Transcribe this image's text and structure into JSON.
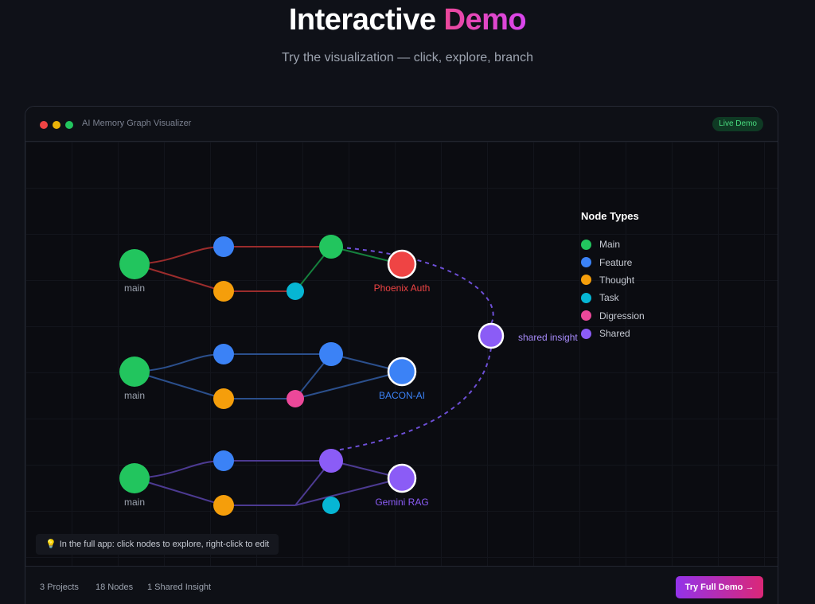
{
  "hero": {
    "title_main": "Interactive",
    "title_accent": "Demo",
    "subtitle": "Try the visualization — click, explore, branch"
  },
  "window": {
    "title": "AI Memory Graph Visualizer",
    "badge": "Live Demo"
  },
  "colors": {
    "main": "#22c55e",
    "feature": "#3b82f6",
    "thought": "#f59e0b",
    "task": "#06b6d4",
    "digression": "#ec4899",
    "shared": "#8b5cf6",
    "phoenix": "#ef4444"
  },
  "legend": {
    "title": "Node Types",
    "items": [
      {
        "label": "Main",
        "color": "#22c55e"
      },
      {
        "label": "Feature",
        "color": "#3b82f6"
      },
      {
        "label": "Thought",
        "color": "#f59e0b"
      },
      {
        "label": "Task",
        "color": "#06b6d4"
      },
      {
        "label": "Digression",
        "color": "#ec4899"
      },
      {
        "label": "Shared",
        "color": "#8b5cf6"
      }
    ]
  },
  "graph": {
    "projects": [
      {
        "name": "Phoenix Auth",
        "name_color": "#ef4444",
        "main_label": "main",
        "edge_color": "#9b2c2c",
        "branch_edge_color": "#15803d",
        "nodes": {
          "main": "main",
          "top1": "feature",
          "bottom1": "thought",
          "bottom2": "task",
          "top2": "main",
          "end": "phoenix"
        }
      },
      {
        "name": "BACON-AI",
        "name_color": "#3b82f6",
        "main_label": "main",
        "edge_color": "#2b4f8c",
        "nodes": {
          "main": "main",
          "top1": "feature",
          "bottom1": "thought",
          "bottom2": "digression",
          "top2": "feature",
          "end": "feature"
        }
      },
      {
        "name": "Gemini RAG",
        "name_color": "#8b5cf6",
        "main_label": "main",
        "edge_color": "#4c3a91",
        "nodes": {
          "main": "main",
          "top1": "feature",
          "bottom1": "thought",
          "bottom2": "task",
          "top2": "shared",
          "end": "shared"
        }
      }
    ],
    "shared_label": "shared insight"
  },
  "hint": {
    "icon": "lightbulb-icon",
    "text": "In the full app: click nodes to explore, right-click to edit"
  },
  "footer": {
    "projects": "3 Projects",
    "nodes": "18 Nodes",
    "shared": "1 Shared Insight",
    "cta": "Try Full Demo →"
  }
}
